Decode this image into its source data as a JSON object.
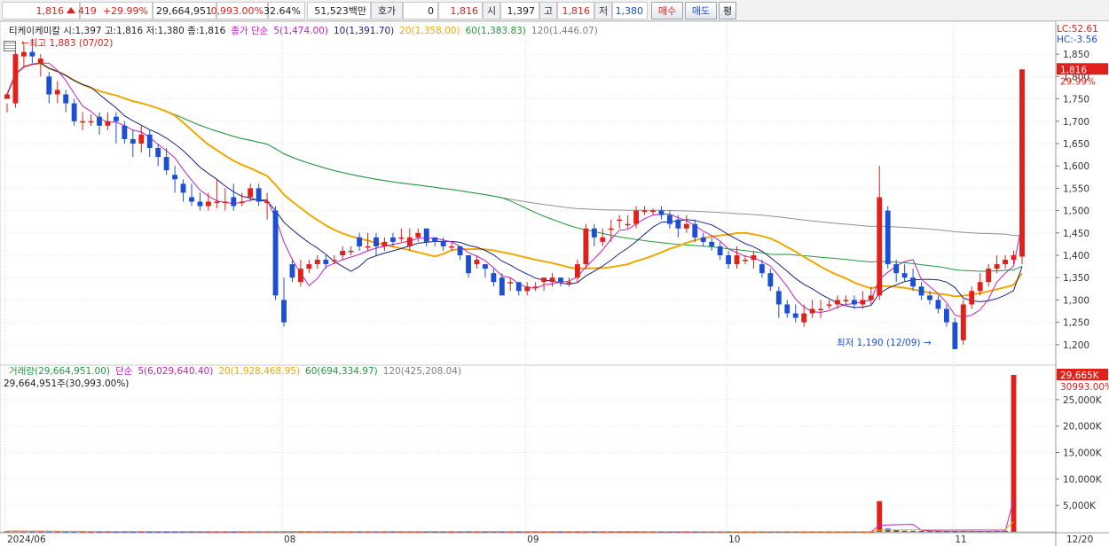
{
  "topbar": {
    "price": "1,816",
    "change": "419",
    "change_pct": "+29.99%",
    "volume": "29,664,951",
    "vol_ratio": "0,993.00%",
    "turnover": "32.64%",
    "amount": "51,523백만",
    "hoga_label": "호가",
    "hoga_value": "0",
    "hoga_price": "1,816",
    "open_label": "시",
    "open_value": "1,397",
    "high_label": "고",
    "high_value": "1,816",
    "low_label": "저",
    "low_value": "1,380",
    "buy_label": "매수",
    "sell_label": "매도",
    "even_label": "평"
  },
  "price_legend": {
    "title": "티케이케미칼 시:1,397 고:1,816 저:1,380 종:1,816",
    "ma_prefix": "종가 단순",
    "ma5": "5(1,474.00)",
    "ma10": "10(1,391.70)",
    "ma20": "20(1,358.00)",
    "ma60": "60(1,383.83)",
    "ma120": "120(1,446.07)",
    "lc": "LC:52.61",
    "hc": "HC:-3.56"
  },
  "volume_legend": {
    "title": "거래량(29,664,951.00)",
    "ma_prefix": "단순",
    "ma5": "5(6,029,640.40)",
    "ma20": "20(1,928,468.95)",
    "ma60": "60(694,334.97)",
    "ma120": "120(425,208.04)",
    "sub": "29,664,951주(30,993.00%)"
  },
  "annotations": {
    "high_note": "←최고 1,883 (07/02)",
    "low_note": "최저 1,190 (12/09) →",
    "price_tag": "1,816",
    "price_tag_pct": "29.99%",
    "vol_tag": "29,665K",
    "vol_tag_pct": "30993.00%"
  },
  "colors": {
    "up": "#e0211b",
    "down": "#1c4fd3",
    "ma5": "#c020c0",
    "ma10": "#1a237e",
    "ma20": "#f0a800",
    "ma60": "#1f9a3c",
    "ma120": "#909090"
  },
  "chart_data": {
    "type": "candlestick",
    "price_axis": {
      "ylim": [
        1160,
        1880
      ],
      "ticks": [
        1850,
        1800,
        1750,
        1700,
        1650,
        1600,
        1550,
        1500,
        1450,
        1400,
        1350,
        1300,
        1250,
        1200
      ]
    },
    "volume_axis": {
      "ylim": [
        0,
        30000
      ],
      "ticks": [
        "25,000K",
        "20,000K",
        "15,000K",
        "10,000K",
        "5,000K"
      ]
    },
    "x_labels": [
      {
        "label": "2024/06",
        "idx": 0
      },
      {
        "label": "08",
        "idx": 33
      },
      {
        "label": "09",
        "idx": 62
      },
      {
        "label": "10",
        "idx": 86
      },
      {
        "label": "11",
        "idx": 113
      },
      {
        "label": "12",
        "idx": 141
      },
      {
        "label": "12/20",
        "idx": 160
      }
    ],
    "candles": [
      [
        1750,
        1760,
        1740,
        1720
      ],
      [
        1740,
        1850,
        1870,
        1730
      ],
      [
        1845,
        1855,
        1870,
        1820
      ],
      [
        1855,
        1845,
        1883,
        1830
      ],
      [
        1830,
        1840,
        1850,
        1800
      ],
      [
        1800,
        1760,
        1810,
        1740
      ],
      [
        1760,
        1770,
        1790,
        1740
      ],
      [
        1760,
        1740,
        1770,
        1720
      ],
      [
        1740,
        1700,
        1750,
        1690
      ],
      [
        1700,
        1700,
        1720,
        1680
      ],
      [
        1700,
        1700,
        1715,
        1690
      ],
      [
        1710,
        1690,
        1720,
        1670
      ],
      [
        1690,
        1700,
        1720,
        1680
      ],
      [
        1710,
        1700,
        1720,
        1650
      ],
      [
        1690,
        1660,
        1700,
        1650
      ],
      [
        1660,
        1650,
        1680,
        1620
      ],
      [
        1650,
        1670,
        1690,
        1630
      ],
      [
        1670,
        1640,
        1680,
        1620
      ],
      [
        1640,
        1620,
        1650,
        1600
      ],
      [
        1620,
        1590,
        1640,
        1580
      ],
      [
        1580,
        1570,
        1600,
        1540
      ],
      [
        1560,
        1540,
        1570,
        1520
      ],
      [
        1530,
        1520,
        1560,
        1510
      ],
      [
        1520,
        1510,
        1540,
        1500
      ],
      [
        1510,
        1520,
        1540,
        1500
      ],
      [
        1520,
        1520,
        1570,
        1505
      ],
      [
        1520,
        1520,
        1550,
        1500
      ],
      [
        1530,
        1510,
        1560,
        1500
      ],
      [
        1520,
        1520,
        1540,
        1510
      ],
      [
        1530,
        1550,
        1560,
        1520
      ],
      [
        1550,
        1520,
        1560,
        1510
      ],
      [
        1520,
        1520,
        1540,
        1480
      ],
      [
        1500,
        1310,
        1510,
        1300
      ],
      [
        1300,
        1250,
        1350,
        1240
      ],
      [
        1380,
        1350,
        1390,
        1340
      ],
      [
        1340,
        1370,
        1390,
        1330
      ],
      [
        1370,
        1380,
        1390,
        1360
      ],
      [
        1380,
        1390,
        1400,
        1370
      ],
      [
        1390,
        1380,
        1400,
        1370
      ],
      [
        1390,
        1390,
        1400,
        1380
      ],
      [
        1400,
        1410,
        1420,
        1390
      ],
      [
        1410,
        1410,
        1420,
        1400
      ],
      [
        1440,
        1420,
        1450,
        1410
      ],
      [
        1420,
        1420,
        1450,
        1410
      ],
      [
        1440,
        1420,
        1450,
        1400
      ],
      [
        1420,
        1430,
        1440,
        1410
      ],
      [
        1440,
        1430,
        1450,
        1420
      ],
      [
        1440,
        1440,
        1460,
        1430
      ],
      [
        1420,
        1440,
        1460,
        1410
      ],
      [
        1440,
        1450,
        1460,
        1430
      ],
      [
        1460,
        1430,
        1460,
        1420
      ],
      [
        1440,
        1430,
        1440,
        1420
      ],
      [
        1430,
        1420,
        1440,
        1410
      ],
      [
        1420,
        1420,
        1430,
        1410
      ],
      [
        1420,
        1400,
        1420,
        1390
      ],
      [
        1400,
        1360,
        1400,
        1350
      ],
      [
        1380,
        1390,
        1400,
        1370
      ],
      [
        1380,
        1370,
        1380,
        1350
      ],
      [
        1360,
        1340,
        1370,
        1330
      ],
      [
        1350,
        1310,
        1360,
        1310
      ],
      [
        1340,
        1340,
        1350,
        1320
      ],
      [
        1340,
        1320,
        1340,
        1310
      ],
      [
        1320,
        1330,
        1340,
        1310
      ],
      [
        1330,
        1330,
        1340,
        1320
      ],
      [
        1340,
        1350,
        1350,
        1320
      ],
      [
        1340,
        1350,
        1360,
        1330
      ],
      [
        1350,
        1340,
        1350,
        1330
      ],
      [
        1340,
        1340,
        1350,
        1330
      ],
      [
        1350,
        1380,
        1390,
        1340
      ],
      [
        1380,
        1460,
        1470,
        1370
      ],
      [
        1460,
        1440,
        1470,
        1420
      ],
      [
        1430,
        1440,
        1460,
        1420
      ],
      [
        1460,
        1460,
        1480,
        1430
      ],
      [
        1480,
        1480,
        1490,
        1460
      ],
      [
        1470,
        1470,
        1490,
        1460
      ],
      [
        1470,
        1500,
        1510,
        1460
      ],
      [
        1500,
        1500,
        1510,
        1490
      ],
      [
        1500,
        1500,
        1505,
        1490
      ],
      [
        1500,
        1490,
        1510,
        1480
      ],
      [
        1490,
        1470,
        1500,
        1460
      ],
      [
        1480,
        1460,
        1490,
        1440
      ],
      [
        1460,
        1470,
        1490,
        1450
      ],
      [
        1470,
        1440,
        1480,
        1430
      ],
      [
        1440,
        1430,
        1450,
        1420
      ],
      [
        1430,
        1420,
        1440,
        1410
      ],
      [
        1420,
        1400,
        1430,
        1390
      ],
      [
        1400,
        1380,
        1410,
        1370
      ],
      [
        1380,
        1400,
        1420,
        1370
      ],
      [
        1390,
        1390,
        1400,
        1380
      ],
      [
        1390,
        1400,
        1410,
        1370
      ],
      [
        1380,
        1360,
        1390,
        1350
      ],
      [
        1360,
        1330,
        1370,
        1320
      ],
      [
        1320,
        1290,
        1330,
        1260
      ],
      [
        1290,
        1270,
        1300,
        1260
      ],
      [
        1270,
        1260,
        1290,
        1250
      ],
      [
        1250,
        1270,
        1290,
        1240
      ],
      [
        1270,
        1280,
        1300,
        1260
      ],
      [
        1280,
        1280,
        1300,
        1260
      ],
      [
        1290,
        1290,
        1300,
        1280
      ],
      [
        1290,
        1300,
        1310,
        1280
      ],
      [
        1300,
        1300,
        1310,
        1290
      ],
      [
        1300,
        1290,
        1310,
        1280
      ],
      [
        1290,
        1300,
        1320,
        1280
      ],
      [
        1300,
        1310,
        1330,
        1290
      ],
      [
        1310,
        1530,
        1600,
        1300
      ],
      [
        1500,
        1380,
        1510,
        1370
      ],
      [
        1380,
        1360,
        1390,
        1340
      ],
      [
        1360,
        1350,
        1380,
        1340
      ],
      [
        1350,
        1330,
        1370,
        1320
      ],
      [
        1330,
        1310,
        1340,
        1300
      ],
      [
        1310,
        1300,
        1320,
        1290
      ],
      [
        1300,
        1280,
        1310,
        1270
      ],
      [
        1280,
        1250,
        1290,
        1240
      ],
      [
        1250,
        1190,
        1260,
        1190
      ],
      [
        1210,
        1290,
        1300,
        1200
      ],
      [
        1290,
        1320,
        1330,
        1280
      ],
      [
        1320,
        1340,
        1360,
        1310
      ],
      [
        1340,
        1370,
        1380,
        1330
      ],
      [
        1370,
        1380,
        1400,
        1360
      ],
      [
        1380,
        1390,
        1400,
        1370
      ],
      [
        1390,
        1400,
        1410,
        1380
      ],
      [
        1397,
        1816,
        1816,
        1380
      ]
    ],
    "volumes": [
      120,
      130,
      110,
      100,
      90,
      80,
      85,
      80,
      75,
      70,
      70,
      65,
      70,
      68,
      66,
      64,
      60,
      62,
      60,
      58,
      56,
      55,
      54,
      52,
      50,
      52,
      50,
      48,
      50,
      52,
      55,
      60,
      70,
      80,
      60,
      50,
      45,
      44,
      42,
      40,
      40,
      40,
      38,
      38,
      36,
      36,
      34,
      34,
      34,
      33,
      32,
      32,
      30,
      30,
      30,
      30,
      30,
      30,
      28,
      28,
      28,
      28,
      28,
      28,
      28,
      26,
      26,
      26,
      26,
      26,
      26,
      26,
      26,
      26,
      24,
      24,
      24,
      24,
      24,
      24,
      24,
      24,
      24,
      24,
      22,
      22,
      22,
      22,
      22,
      22,
      22,
      22,
      22,
      22,
      22,
      22,
      22,
      22,
      22,
      22,
      22,
      22,
      22,
      22,
      5800,
      600,
      300,
      200,
      180,
      160,
      150,
      140,
      140,
      130,
      160,
      170,
      160,
      160,
      180,
      200,
      29665
    ],
    "series": [
      {
        "name": "5",
        "line": "ma5"
      },
      {
        "name": "10",
        "line": "ma10"
      },
      {
        "name": "20",
        "line": "ma20"
      },
      {
        "name": "60",
        "line": "ma60"
      },
      {
        "name": "120",
        "line": "ma120"
      }
    ]
  }
}
